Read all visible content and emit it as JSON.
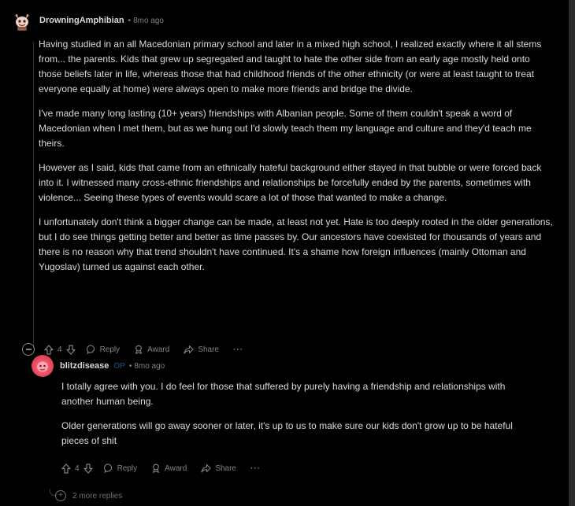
{
  "comments": [
    {
      "username": "DrowningAmphibian",
      "separator": "•",
      "time": "8mo ago",
      "avatar_icon": "snoo-avatar-icon",
      "paragraphs": [
        "Having studied in an all Macedonian primary school and later in a mixed high school, I realized exactly where it all stems from... the parents. Kids that grew up segregated and taught to hate the other side from an early age mostly held onto those beliefs later in life, whereas those that had childhood friends of the other ethnicity (or were at least taught to treat everyone equally at home) were always open to make more friends and bridge the divide.",
        "I've made many long lasting (10+ years) friendships with Albanian people. Some of them couldn't speak a word of Macedonian when I met them, but as we hung out I'd slowly teach them my language and culture and they'd teach me theirs.",
        "However as I said, kids that came from an ethnically hateful background either stayed in that bubble or were forced back into it. I witnessed many cross-ethnic friendships and relationships be forcefully ended by the parents, sometimes with violence... Seeing these types of events would scare a lot of those that wanted to make a change.",
        "I unfortunately don't think a bigger change can be made, at least not yet. Hate is too deeply rooted in the older generations, but I do see things getting better and better as time passes by. Our ancestors have coexisted for thousands of years and there is no reason why that trend shouldn't have continued. It's a shame how foreign influences (mainly Ottoman and Yugoslav) turned us against each other."
      ],
      "votes": "4",
      "reply_label": "Reply",
      "award_label": "Award",
      "share_label": "Share",
      "more_label": "···"
    },
    {
      "username": "blitzdisease",
      "op_tag": "OP",
      "separator": "•",
      "time": "8mo ago",
      "avatar_icon": "snoo-avatar-icon",
      "paragraphs": [
        "I totally agree with you. I do feel for those that suffered by purely having a friendship and relationships with another human being.",
        "Older generations will go away sooner or later, it's up to us to make sure our kids don't grow up to be hateful pieces of shit"
      ],
      "votes": "4",
      "reply_label": "Reply",
      "award_label": "Award",
      "share_label": "Share",
      "more_label": "···"
    }
  ],
  "more_replies": "2 more replies",
  "colors": {
    "background": "#000000",
    "text": "#d7dadc",
    "meta": "#818384",
    "op_tag": "#24a0ed",
    "avatar_pink": "#e7495c"
  }
}
